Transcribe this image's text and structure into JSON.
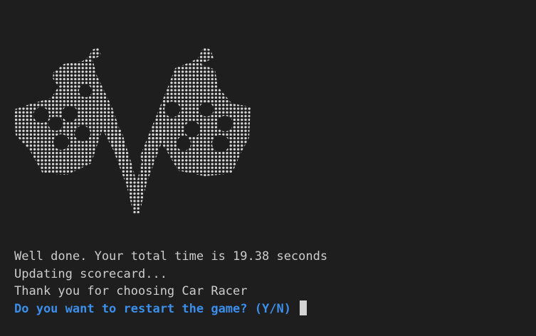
{
  "terminal": {
    "background": "#1e1e1e",
    "art_color": "#d9d9d9",
    "art_icon": "checkered-flags-victory-dots-icon",
    "lines": [
      "Well done. Your total time is 19.38 seconds",
      "Updating scorecard...",
      "Thank you for choosing Car Racer"
    ],
    "prompt": "Do you want to restart the game? (Y/N)",
    "prompt_color": "#3b8eea"
  }
}
